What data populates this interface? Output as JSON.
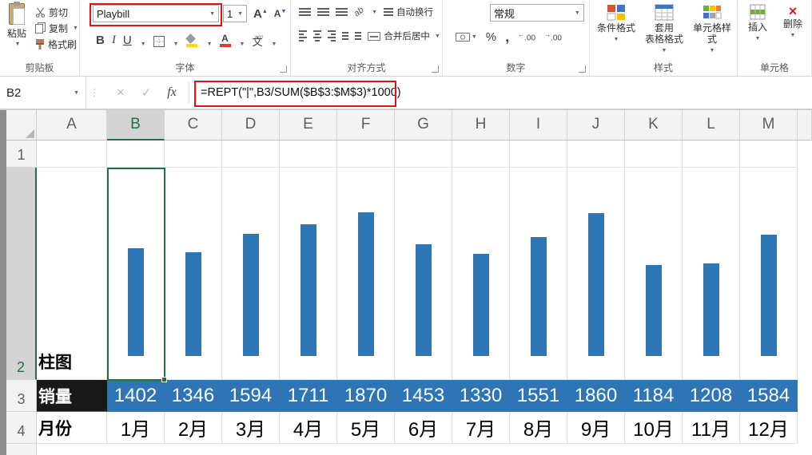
{
  "ribbon": {
    "clipboard": {
      "group_label": "剪贴板",
      "paste_label": "粘贴",
      "cut_label": "剪切",
      "copy_label": "复制",
      "format_painter_label": "格式刷"
    },
    "font": {
      "group_label": "字体",
      "font_name": "Playbill",
      "font_size": "1",
      "bold_label": "B",
      "italic_label": "I",
      "underline_label": "U",
      "grow_font_label": "A",
      "shrink_font_label": "A",
      "font_color_label": "A",
      "phonetic_label": "文"
    },
    "alignment": {
      "group_label": "对齐方式",
      "wrap_label": "自动换行",
      "merge_label": "合并后居中",
      "orientation_label": "ab"
    },
    "number": {
      "group_label": "数字",
      "format_value": "常规",
      "percent_label": "%",
      "comma_label": ",",
      "increase_decimal_label": ".00",
      "decrease_decimal_label": ".00"
    },
    "styles": {
      "group_label": "样式",
      "conditional_label": "条件格式",
      "table_style_line1": "套用",
      "table_style_line2": "表格格式",
      "cell_styles_label": "单元格样式"
    },
    "cells": {
      "group_label": "单元格",
      "insert_label": "插入",
      "delete_label": "删除"
    }
  },
  "formula_bar": {
    "name_box_value": "B2",
    "cancel_label": "×",
    "enter_label": "✓",
    "fx_label": "fx",
    "formula": "=REPT(\"|\",B3/SUM($B$3:$M$3)*1000)"
  },
  "sheet": {
    "column_headers": [
      "A",
      "B",
      "C",
      "D",
      "E",
      "F",
      "G",
      "H",
      "I",
      "J",
      "K",
      "L",
      "M"
    ],
    "row_headers": [
      "1",
      "2",
      "3",
      "4"
    ],
    "selected_cell": "B2",
    "selected_column": "B",
    "selected_row": "2",
    "a_column_labels": {
      "row2": "柱图",
      "row3": "销量",
      "row4": "月份"
    }
  },
  "chart_data": {
    "type": "bar",
    "title": "柱图",
    "series_name": "销量",
    "categories": [
      "1月",
      "2月",
      "3月",
      "4月",
      "5月",
      "6月",
      "7月",
      "8月",
      "9月",
      "10月",
      "11月",
      "12月"
    ],
    "values": [
      1402,
      1346,
      1594,
      1711,
      1870,
      1453,
      1330,
      1551,
      1860,
      1184,
      1208,
      1584
    ],
    "bar_color": "#2E75B6",
    "xlabel": "月份",
    "ylabel": "销量",
    "legend": false,
    "grid": false
  },
  "colors": {
    "bar_blue": "#2E75B6",
    "selection_green": "#1E7145",
    "annotation_red": "#DE1414",
    "series_label_bg": "#191919"
  }
}
